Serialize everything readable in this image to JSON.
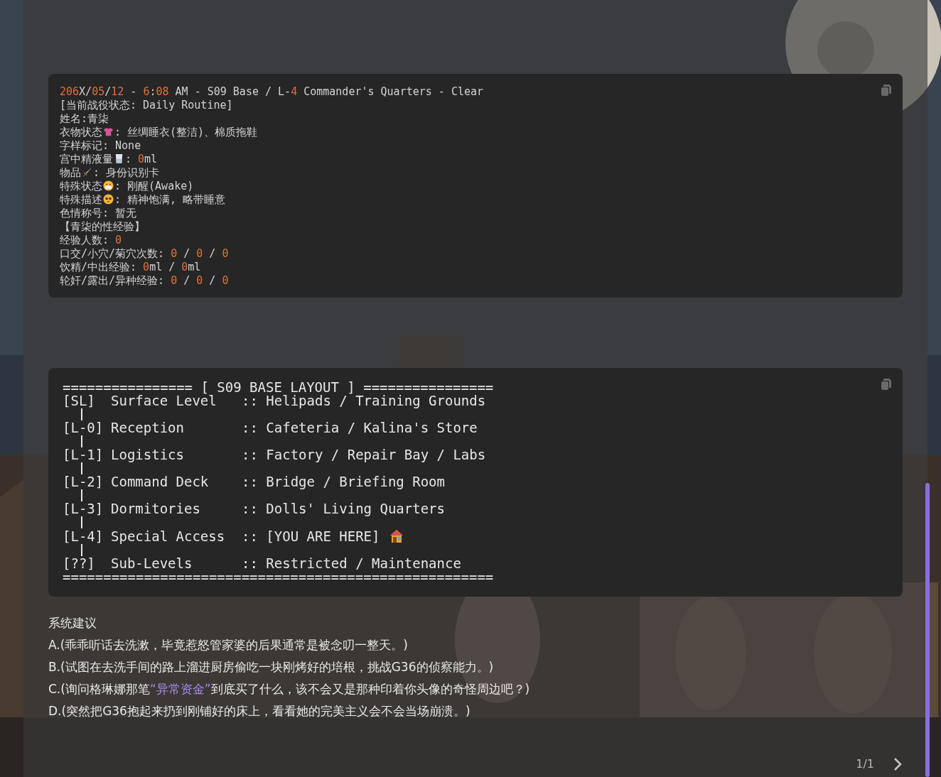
{
  "status_panel": {
    "lines": [
      [
        {
          "kind": "accent",
          "text": "206"
        },
        {
          "kind": "plain",
          "text": "X/"
        },
        {
          "kind": "accent",
          "text": "05"
        },
        {
          "kind": "plain",
          "text": "/"
        },
        {
          "kind": "accent",
          "text": "12"
        },
        {
          "kind": "plain",
          "text": " - "
        },
        {
          "kind": "accent",
          "text": "6"
        },
        {
          "kind": "plain",
          "text": ":"
        },
        {
          "kind": "accent",
          "text": "08"
        },
        {
          "kind": "plain",
          "text": " AM - S09 Base / L-"
        },
        {
          "kind": "accent",
          "text": "4"
        },
        {
          "kind": "plain",
          "text": " Commander's Quarters - Clear"
        }
      ],
      [
        {
          "kind": "plain",
          "text": "[当前战役状态: Daily Routine]"
        }
      ],
      [
        {
          "kind": "plain",
          "text": "姓名:青柒"
        }
      ],
      [
        {
          "kind": "plain",
          "text": "衣物状态"
        },
        {
          "kind": "icon"
        },
        {
          "kind": "plain",
          "text": ": 丝绸睡衣(整洁)、棉质拖鞋"
        }
      ],
      [
        {
          "kind": "plain",
          "text": "字样标记: None"
        }
      ],
      [
        {
          "kind": "plain",
          "text": "宫中精液量"
        },
        {
          "kind": "icon"
        },
        {
          "kind": "plain",
          "text": ": "
        },
        {
          "kind": "accent",
          "text": "0"
        },
        {
          "kind": "plain",
          "text": "ml"
        }
      ],
      [
        {
          "kind": "plain",
          "text": "物品"
        },
        {
          "kind": "icon"
        },
        {
          "kind": "plain",
          "text": ": 身份识别卡"
        }
      ],
      [
        {
          "kind": "plain",
          "text": "特殊状态"
        },
        {
          "kind": "icon"
        },
        {
          "kind": "plain",
          "text": ": 刚醒(Awake)"
        }
      ],
      [
        {
          "kind": "plain",
          "text": "特殊描述"
        },
        {
          "kind": "icon"
        },
        {
          "kind": "plain",
          "text": ": 精神饱满, 略带睡意"
        }
      ],
      [
        {
          "kind": "plain",
          "text": "色情称号: 暂无"
        }
      ],
      [
        {
          "kind": "plain",
          "text": "【青柒的性经验】"
        }
      ],
      [
        {
          "kind": "plain",
          "text": "经验人数: "
        },
        {
          "kind": "accent",
          "text": "0"
        }
      ],
      [
        {
          "kind": "plain",
          "text": "口交/小穴/菊穴次数: "
        },
        {
          "kind": "accent",
          "text": "0"
        },
        {
          "kind": "plain",
          "text": " / "
        },
        {
          "kind": "accent",
          "text": "0"
        },
        {
          "kind": "plain",
          "text": " / "
        },
        {
          "kind": "accent",
          "text": "0"
        }
      ],
      [
        {
          "kind": "plain",
          "text": "饮精/中出经验: "
        },
        {
          "kind": "accent",
          "text": "0"
        },
        {
          "kind": "plain",
          "text": "ml / "
        },
        {
          "kind": "accent",
          "text": "0"
        },
        {
          "kind": "plain",
          "text": "ml"
        }
      ],
      [
        {
          "kind": "plain",
          "text": "轮奸/露出/异种经验: "
        },
        {
          "kind": "accent",
          "text": "0"
        },
        {
          "kind": "plain",
          "text": " / "
        },
        {
          "kind": "accent",
          "text": "0"
        },
        {
          "kind": "plain",
          "text": " / "
        },
        {
          "kind": "accent",
          "text": "0"
        }
      ]
    ]
  },
  "layout_panel": {
    "header": "================ [ S09 BASE LAYOUT ] ================",
    "rows": [
      {
        "code": "[SL]",
        "name": "Surface Level",
        "rooms": ":: Helipads / Training Grounds",
        "here": false
      },
      {
        "code": "[L-0]",
        "name": "Reception",
        "rooms": ":: Cafeteria / Kalina's Store",
        "here": false
      },
      {
        "code": "[L-1]",
        "name": "Logistics",
        "rooms": ":: Factory / Repair Bay / Labs",
        "here": false
      },
      {
        "code": "[L-2]",
        "name": "Command Deck",
        "rooms": ":: Bridge / Briefing Room",
        "here": false
      },
      {
        "code": "[L-3]",
        "name": "Dormitories",
        "rooms": ":: Dolls' Living Quarters",
        "here": false
      },
      {
        "code": "[L-4]",
        "name": "Special Access",
        "rooms": ":: [YOU ARE HERE]",
        "here": true
      },
      {
        "code": "[??]",
        "name": "Sub-Levels",
        "rooms": ":: Restricted / Maintenance",
        "here": false
      }
    ],
    "footer": "====================================================="
  },
  "suggestions": {
    "title": "系统建议",
    "options": [
      [
        {
          "kind": "plain",
          "text": "A.(乖乖听话去洗漱，毕竟惹怒管家婆的后果通常是被念叨一整天。)"
        }
      ],
      [
        {
          "kind": "plain",
          "text": "B.(试图在去洗手间的路上溜进厨房偷吃一块刚烤好的培根，挑战G36的侦察能力。)"
        }
      ],
      [
        {
          "kind": "plain",
          "text": "C.(询问格琳娜那笔"
        },
        {
          "kind": "quote",
          "text": "“异常资金”"
        },
        {
          "kind": "plain",
          "text": "到底买了什么，该不会又是那种印着你头像的奇怪周边吧？)"
        }
      ],
      [
        {
          "kind": "plain",
          "text": "D.(突然把G36抱起来扔到刚铺好的床上，看看她的完美主义会不会当场崩溃。)"
        }
      ]
    ]
  },
  "pager": {
    "label": "1/1"
  }
}
